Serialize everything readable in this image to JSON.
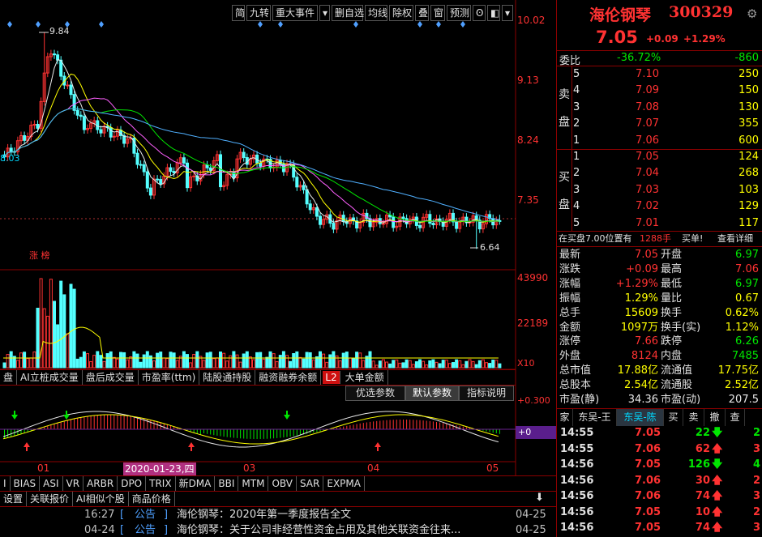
{
  "toolbar": {
    "items": [
      "简",
      "九转",
      "重大事件",
      "▾",
      "删自选",
      "均线",
      "除权",
      "叠",
      "窗",
      "预测",
      "ʘ",
      "◧",
      "▾"
    ]
  },
  "chart": {
    "price_axis": [
      "10.02",
      "9.13",
      "8.24",
      "7.35"
    ],
    "high_label": "9.84",
    "low_label": "6.64",
    "left_price": "8.03",
    "zt_label": "涨 榜",
    "vol_axis": [
      "43990",
      "22189",
      "X10"
    ],
    "macd_axis": [
      "+0.300",
      "+0"
    ],
    "date_labels": [
      "01",
      "03",
      "04",
      "05"
    ],
    "cursor_date": "2020-01-23,四"
  },
  "chart_data": {
    "type": "candlestick",
    "ylim": [
      6.5,
      10.1
    ],
    "y_ticks": [
      10.02,
      9.13,
      8.24,
      7.35
    ],
    "last_close": 7.05,
    "high": 9.84,
    "low": 6.64
  },
  "indicator_tabs": [
    "盘",
    "AI立桩成交量",
    "盘后成交量",
    "市盈率(ttm)",
    "陆股通持股",
    "融资融券余额",
    "L2",
    "大单金额"
  ],
  "param_buttons": [
    "优选参数",
    "默认参数",
    "指标说明"
  ],
  "index_tabs": [
    "I",
    "BIAS",
    "ASI",
    "VR",
    "ARBR",
    "DPO",
    "TRIX",
    "新DMA",
    "BBI",
    "MTM",
    "OBV",
    "SAR",
    "EXPMA"
  ],
  "bottom_tabs": [
    "设置",
    "关联报价",
    "AI相似个股",
    "商品价格"
  ],
  "news": [
    {
      "time": "16:27",
      "tag": "公告",
      "text": "海伦钢琴：2020年第一季度报告全文",
      "date": "04-25"
    },
    {
      "time": "04-24",
      "tag": "公告",
      "text": "海伦钢琴：关于公司非经营性资金占用及其他关联资金往来...",
      "date": "04-25"
    }
  ],
  "quote_header": {
    "name": "海伦钢琴",
    "code": "300329",
    "price": "7.05",
    "change": "+0.09",
    "pct": "+1.29%"
  },
  "weibi": {
    "label": "委比",
    "pct": "-36.72%",
    "diff": "-860"
  },
  "sell_label": [
    "卖",
    "盘"
  ],
  "buy_label": [
    "买",
    "盘"
  ],
  "sell_orders": [
    {
      "lvl": "5",
      "price": "7.10",
      "vol": "250"
    },
    {
      "lvl": "4",
      "price": "7.09",
      "vol": "150"
    },
    {
      "lvl": "3",
      "price": "7.08",
      "vol": "130"
    },
    {
      "lvl": "2",
      "price": "7.07",
      "vol": "355"
    },
    {
      "lvl": "1",
      "price": "7.06",
      "vol": "600"
    }
  ],
  "buy_orders": [
    {
      "lvl": "1",
      "price": "7.05",
      "vol": "124"
    },
    {
      "lvl": "2",
      "price": "7.04",
      "vol": "268"
    },
    {
      "lvl": "3",
      "price": "7.03",
      "vol": "103"
    },
    {
      "lvl": "4",
      "price": "7.02",
      "vol": "129"
    },
    {
      "lvl": "5",
      "price": "7.01",
      "vol": "117"
    }
  ],
  "buy_notice": {
    "text": "在买盘7.00位置有",
    "qty": "1288手",
    "action": "买单!",
    "link": "查看详细"
  },
  "quote_rows": [
    {
      "l1": "最新",
      "v1": "7.05",
      "c1": "red",
      "l2": "开盘",
      "v2": "6.97",
      "c2": "grn"
    },
    {
      "l1": "涨跌",
      "v1": "+0.09",
      "c1": "red",
      "l2": "最高",
      "v2": "7.06",
      "c2": "red"
    },
    {
      "l1": "涨幅",
      "v1": "+1.29%",
      "c1": "red",
      "l2": "最低",
      "v2": "6.97",
      "c2": "grn"
    },
    {
      "l1": "振幅",
      "v1": "1.29%",
      "c1": "yel",
      "l2": "量比",
      "v2": "0.67",
      "c2": "yel"
    },
    {
      "l1": "总手",
      "v1": "15609",
      "c1": "yel",
      "l2": "换手",
      "v2": "0.62%",
      "c2": "yel"
    },
    {
      "l1": "金额",
      "v1": "1097万",
      "c1": "yel",
      "l2": "换手(实)",
      "v2": "1.12%",
      "c2": "yel"
    },
    {
      "l1": "涨停",
      "v1": "7.66",
      "c1": "red",
      "l2": "跌停",
      "v2": "6.26",
      "c2": "grn"
    },
    {
      "l1": "外盘",
      "v1": "8124",
      "c1": "red",
      "l2": "内盘",
      "v2": "7485",
      "c2": "grn"
    },
    {
      "l1": "总市值",
      "v1": "17.88亿",
      "c1": "yel",
      "l2": "流通值",
      "v2": "17.75亿",
      "c2": "yel"
    },
    {
      "l1": "总股本",
      "v1": "2.54亿",
      "c1": "yel",
      "l2": "流通股",
      "v2": "2.52亿",
      "c2": "yel"
    },
    {
      "l1": "市盈(静)",
      "v1": "34.36",
      "c1": "wht",
      "l2": "市盈(动)",
      "v2": "207.5",
      "c2": "wht"
    }
  ],
  "trade_tabs": [
    "家",
    "东吴-王",
    "东吴-陈",
    "买",
    "卖",
    "撤",
    "查"
  ],
  "ticks": [
    {
      "time": "14:55",
      "price": "7.05",
      "vol": "22",
      "dir": "down",
      "n": "2"
    },
    {
      "time": "14:55",
      "price": "7.06",
      "vol": "62",
      "dir": "up",
      "n": "3"
    },
    {
      "time": "14:56",
      "price": "7.05",
      "vol": "126",
      "dir": "down",
      "n": "4"
    },
    {
      "time": "14:56",
      "price": "7.06",
      "vol": "30",
      "dir": "up",
      "n": "2"
    },
    {
      "time": "14:56",
      "price": "7.06",
      "vol": "74",
      "dir": "up",
      "n": "3"
    },
    {
      "time": "14:56",
      "price": "7.05",
      "vol": "10",
      "dir": "up",
      "n": "2"
    },
    {
      "time": "14:56",
      "price": "7.05",
      "vol": "74",
      "dir": "up",
      "n": "3"
    }
  ]
}
